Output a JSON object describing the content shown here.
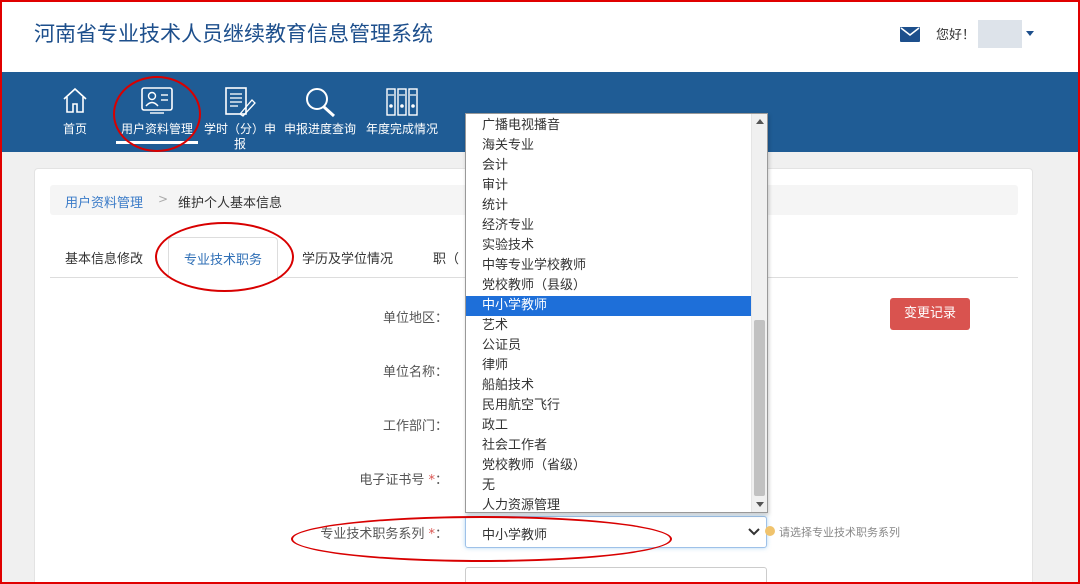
{
  "header": {
    "title": "河南省专业技术人员继续教育信息管理系统",
    "greeting": "您好！"
  },
  "nav": {
    "items": [
      {
        "label": "首页"
      },
      {
        "label": "用户资料管理"
      },
      {
        "label": "学时（分）申报"
      },
      {
        "label": "申报进度查询"
      },
      {
        "label": "年度完成情况"
      }
    ]
  },
  "breadcrumb": {
    "link": "用户资料管理",
    "separator": ">",
    "current": "维护个人基本信息"
  },
  "tabs": [
    {
      "label": "基本信息修改"
    },
    {
      "label": "专业技术职务"
    },
    {
      "label": "学历及学位情况"
    },
    {
      "label": "职（"
    }
  ],
  "form": {
    "labels": {
      "region": "单位地区：",
      "unit": "单位名称：",
      "dept": "工作部门：",
      "cert": "电子证书号",
      "series": "专业技术职务系列"
    },
    "colon": "：",
    "required_mark": "*",
    "series_value": "中小学教师",
    "series_help": "请选择专业技术职务系列",
    "change_button": "变更记录"
  },
  "dropdown": {
    "options": [
      "广播电视播音",
      "海关专业",
      "会计",
      "审计",
      "统计",
      "经济专业",
      "实验技术",
      "中等专业学校教师",
      "党校教师（县级）",
      "中小学教师",
      "艺术",
      "公证员",
      "律师",
      "船舶技术",
      "民用航空飞行",
      "政工",
      "社会工作者",
      "党校教师（省级）",
      "无",
      "人力资源管理"
    ],
    "selected_index": 9
  },
  "colors": {
    "brand": "#1d4f8c",
    "nav_bg": "#1f5c95",
    "danger": "#d9534f",
    "selected": "#1e6fd9",
    "annotation": "#d80000"
  }
}
